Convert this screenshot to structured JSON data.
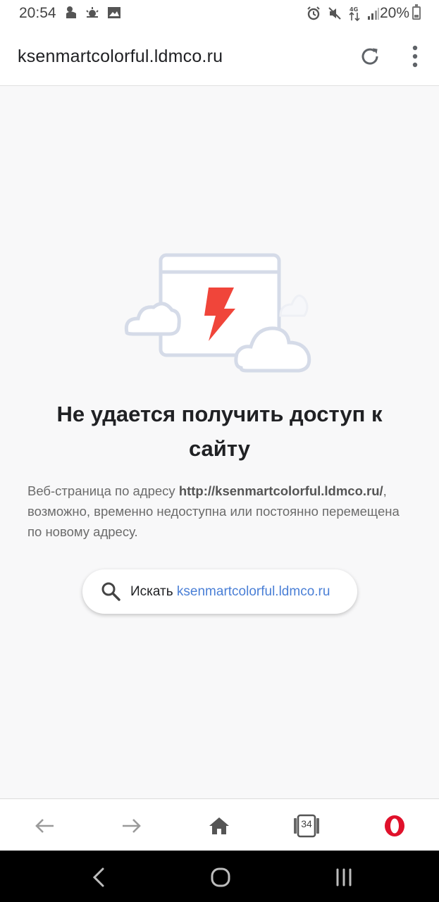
{
  "status_bar": {
    "time": "20:54",
    "battery": "20%",
    "network": "4G",
    "left_icons": [
      "android-icon",
      "weather-icon",
      "image-icon"
    ],
    "right_icons": [
      "alarm-icon",
      "mute-icon",
      "data-arrows-icon",
      "signal-icon",
      "battery-icon"
    ]
  },
  "address_bar": {
    "url": "ksenmartcolorful.ldmco.ru",
    "reload_icon": "reload-icon",
    "menu_icon": "more-vert-icon"
  },
  "error": {
    "title": "Не удается получить доступ к сайту",
    "desc_before": "Веб-страница по адресу ",
    "desc_url": "http://ksenmartcolorful.ldmco.ru/",
    "desc_after": ", возможно, временно недоступна или постоянно перемещена по новому адресу."
  },
  "search_button": {
    "label": "Искать ",
    "query": "ksenmartcolorful.ldmco.ru"
  },
  "toolbar": {
    "tab_count": "34",
    "items": [
      "back-icon",
      "forward-icon",
      "home-icon",
      "tabs-icon",
      "opera-icon"
    ]
  },
  "colors": {
    "accent_link": "#4a7fd6",
    "bolt": "#f0453a",
    "illustration_line": "#d5dbe8",
    "opera_red": "#e0112b"
  }
}
